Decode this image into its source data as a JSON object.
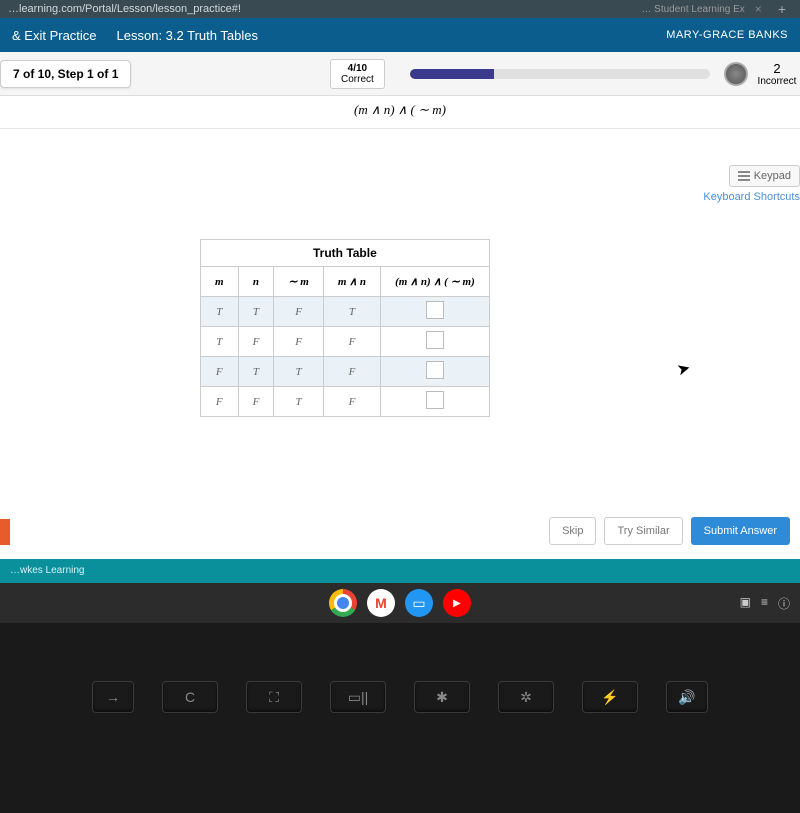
{
  "browser": {
    "url": "…learning.com/Portal/Lesson/lesson_practice#!",
    "tab_title": "… Student Learning Ex",
    "tab_close": "×",
    "new_tab": "+"
  },
  "topnav": {
    "exit": "& Exit Practice",
    "lesson": "Lesson: 3.2 Truth Tables",
    "user": "MARY-GRACE BANKS"
  },
  "progress": {
    "step": "7 of 10,  Step 1 of 1",
    "score_frac": "4/10",
    "score_label": "Correct",
    "incorrect_num": "2",
    "incorrect_label": "Incorrect"
  },
  "expression": "(m ∧ n) ∧ ( ∼ m)",
  "keypad": {
    "button": "Keypad",
    "shortcut": "Keyboard Shortcuts"
  },
  "table": {
    "caption": "Truth Table",
    "headers": [
      "m",
      "n",
      "∼ m",
      "m ∧ n",
      "(m ∧ n) ∧ ( ∼ m)"
    ],
    "rows": [
      [
        "T",
        "T",
        "F",
        "T"
      ],
      [
        "T",
        "F",
        "F",
        "F"
      ],
      [
        "F",
        "T",
        "T",
        "F"
      ],
      [
        "F",
        "F",
        "T",
        "F"
      ]
    ]
  },
  "actions": {
    "skip": "Skip",
    "try": "Try Similar",
    "submit": "Submit Answer"
  },
  "footer": {
    "brand": "…wkes Learning"
  },
  "keyboard_keys": [
    "→",
    "C",
    "⛶",
    "▭||",
    "✱",
    "✲",
    "⚡",
    "🔊"
  ]
}
